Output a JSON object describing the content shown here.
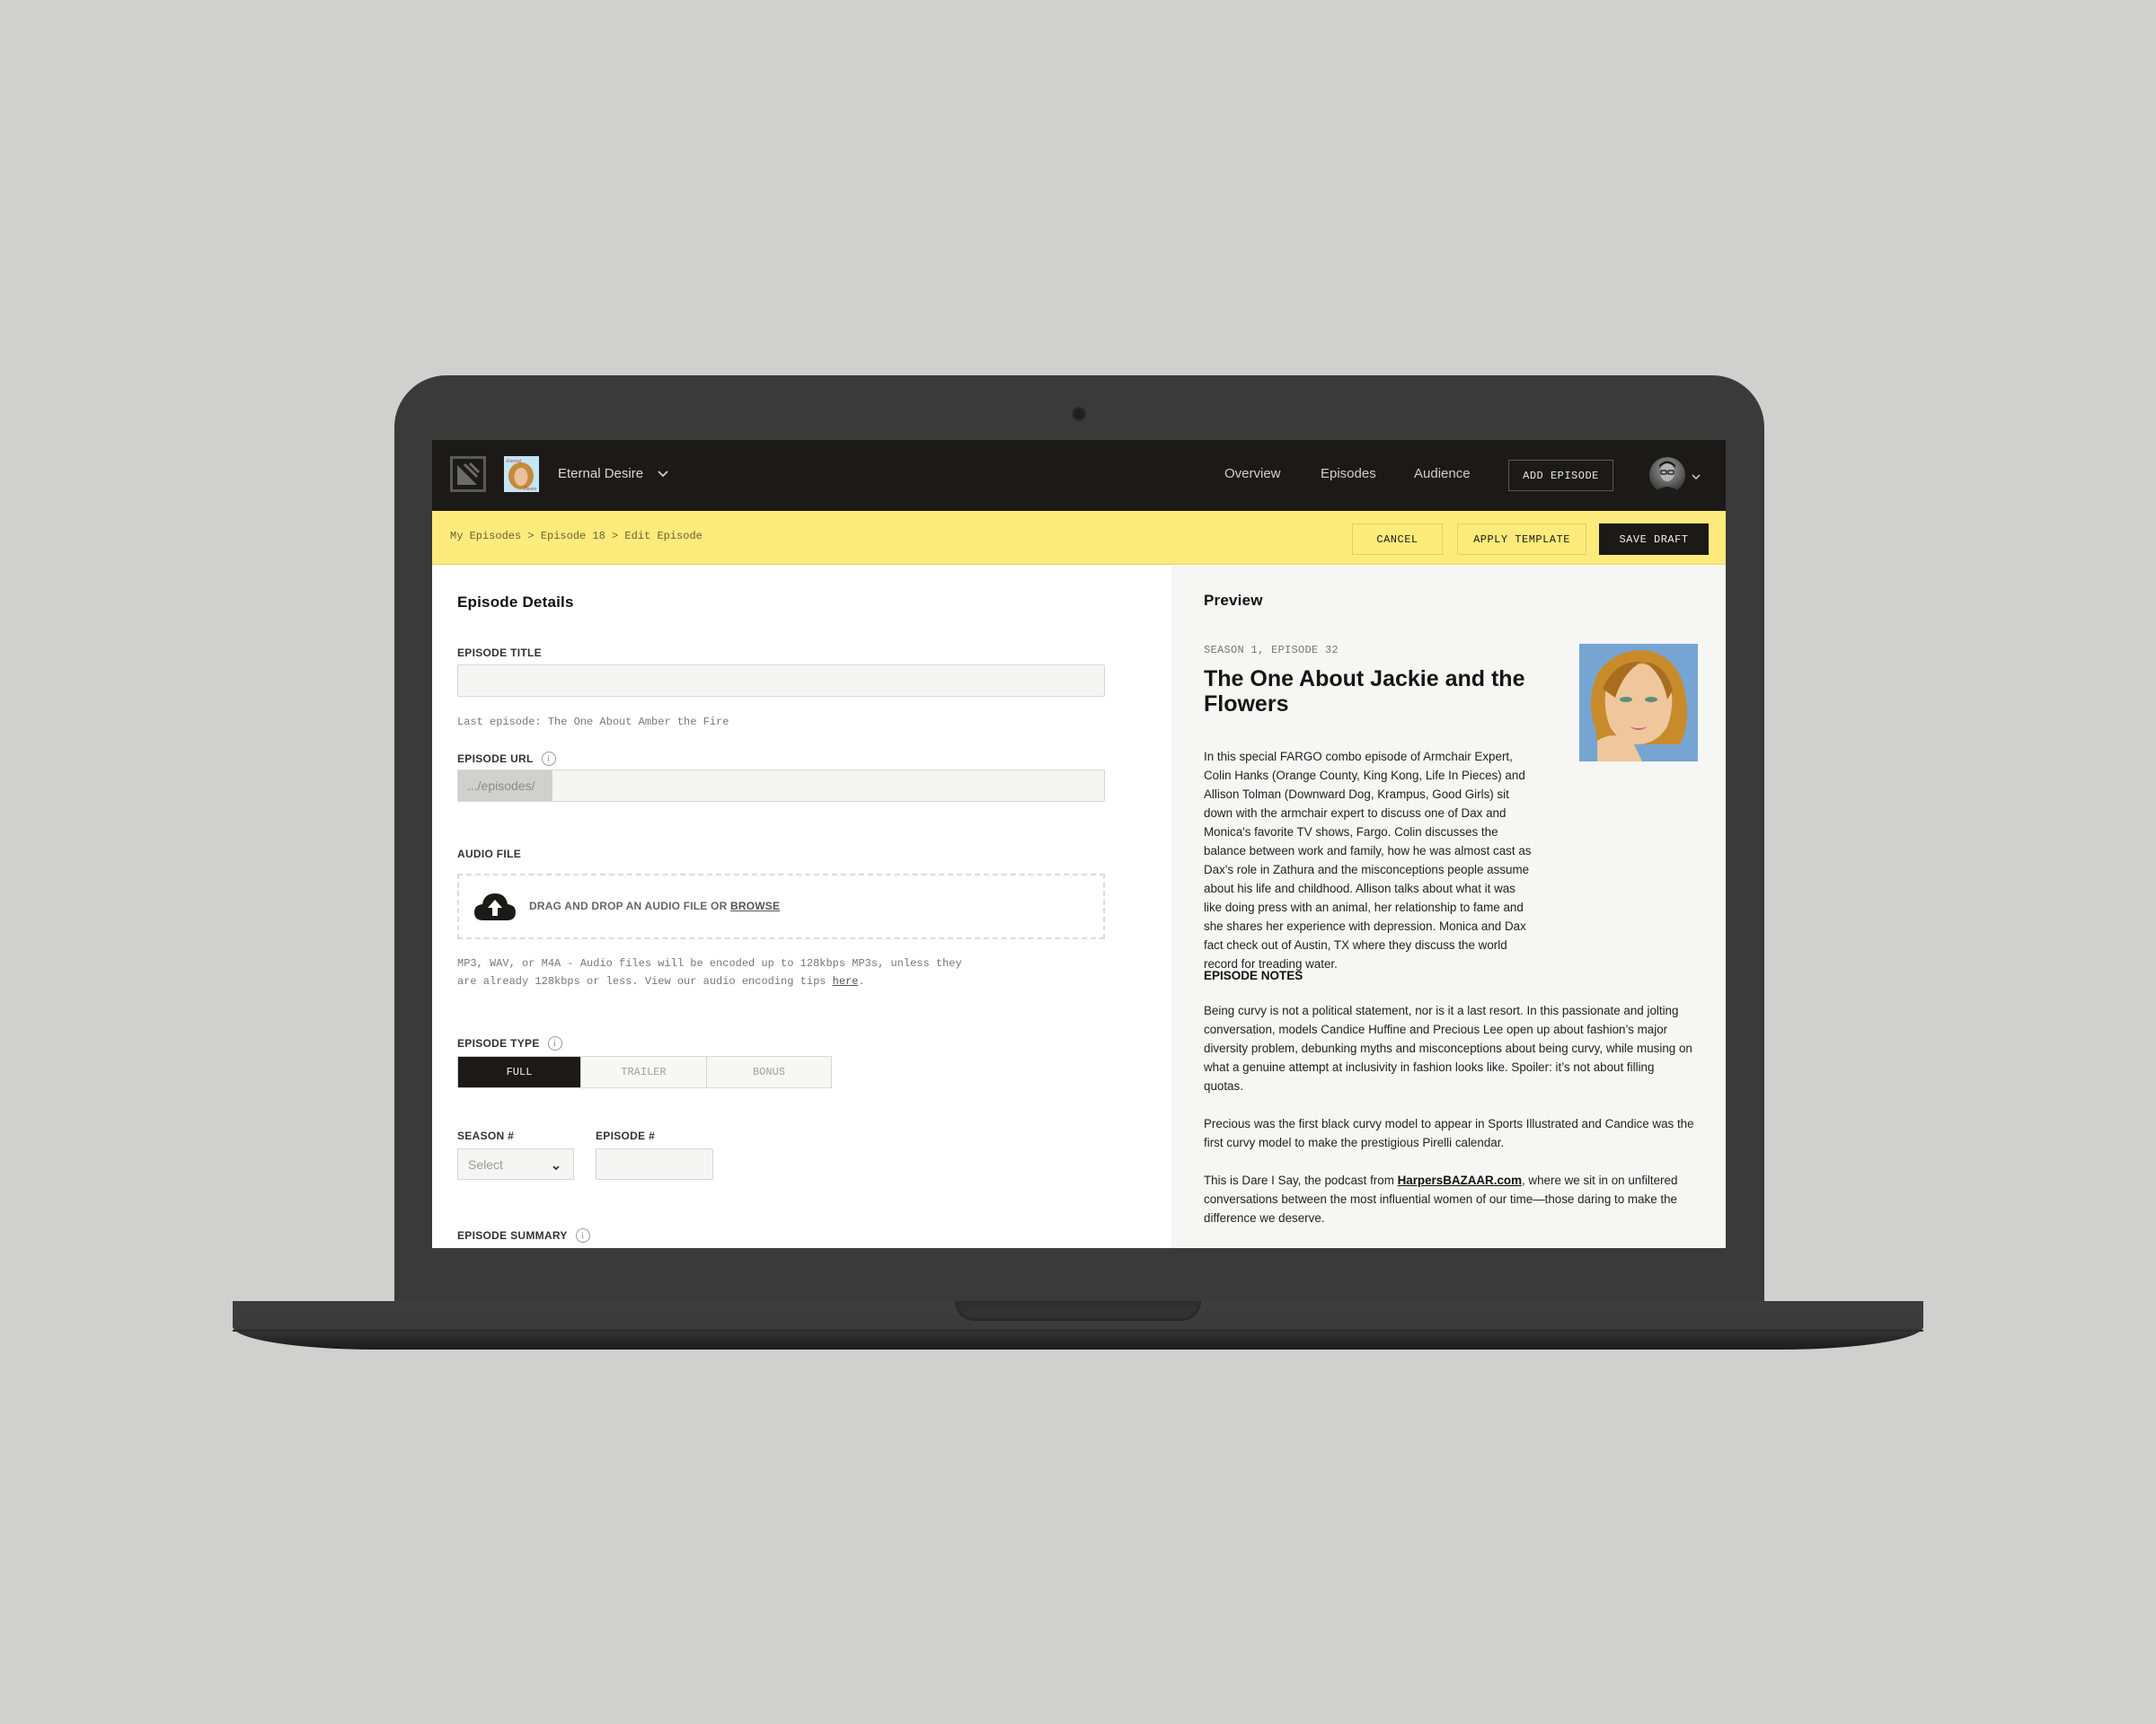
{
  "nav": {
    "podcast_name": "Eternal Desire",
    "links": [
      "Overview",
      "Episodes",
      "Audience"
    ],
    "add_episode_label": "ADD EPISODE",
    "icons": {
      "logo": "brand-logo-icon",
      "podcast_art": "podcast-cover-thumbnail",
      "dropdown": "chevron-down-icon",
      "avatar": "user-avatar"
    }
  },
  "toolbar": {
    "breadcrumb": "My Episodes > Episode 18 > Edit Episode",
    "cancel_label": "CANCEL",
    "apply_template_label": "APPLY TEMPLATE",
    "save_draft_label": "SAVE DRAFT"
  },
  "form": {
    "heading": "Episode Details",
    "episode_title": {
      "label": "EPISODE TITLE",
      "value": "",
      "hint": "Last episode: The One About Amber the Fire"
    },
    "episode_url": {
      "label": "EPISODE URL",
      "prefix": ".../episodes/",
      "value": ""
    },
    "audio_file": {
      "label": "AUDIO FILE",
      "drop_text": "DRAG AND DROP AN AUDIO FILE OR",
      "browse_label": "BROWSE",
      "help_line1": "MP3, WAV, or M4A - Audio files will be encoded up to 128kbps MP3s, unless they",
      "help_line2_prefix": "are already 128kbps or less. View our audio encoding tips ",
      "help_link": "here",
      "help_suffix": "."
    },
    "episode_type": {
      "label": "EPISODE TYPE",
      "options": [
        "FULL",
        "TRAILER",
        "BONUS"
      ],
      "selected": "FULL"
    },
    "season": {
      "label": "SEASON #",
      "placeholder": "Select"
    },
    "episode_number": {
      "label": "EPISODE #",
      "value": ""
    },
    "episode_summary": {
      "label": "EPISODE SUMMARY"
    }
  },
  "preview": {
    "heading": "Preview",
    "meta": "SEASON 1, EPISODE 32",
    "title": "The One About Jackie and the Flowers",
    "description": "In this special FARGO combo episode of Armchair Expert, Colin Hanks (Orange County, King Kong, Life In Pieces) and Allison Tolman (Downward Dog, Krampus, Good Girls) sit down with the armchair expert to discuss one of Dax and Monica's favorite TV shows, Fargo. Colin discusses the balance between work and family, how he was almost cast as Dax's role in Zathura and the misconceptions people assume about his life and childhood. Allison talks about what it was like doing press with an animal, her relationship to fame and she shares her experience with depression. Monica and Dax fact check out of Austin, TX where they discuss the world record for treading water.",
    "notes_heading": "EPISODE NOTES",
    "notes_p1": "Being curvy is not a political statement, nor is it a last resort. In this passionate and jolting conversation, models Candice Huffine and Precious Lee open up about fashion’s major diversity problem, debunking myths and misconceptions about being curvy, while musing on what a genuine attempt at inclusivity in fashion looks like. Spoiler: it’s not about filling quotas.",
    "notes_p2": "Precious was the first black curvy model to appear in Sports Illustrated and Candice was the first curvy model to make the prestigious Pirelli calendar.",
    "notes_p3_prefix": "This is Dare I Say, the podcast from ",
    "notes_p3_link": "HarpersBAZAAR.com",
    "notes_p3_suffix": ", where we sit in on unfiltered conversations between the most influential women of our time—those daring to make the difference we deserve."
  },
  "colors": {
    "nav_bg": "#1c1a17",
    "toolbar_bg": "#fdeb7c",
    "preview_bg": "#f6f6f5",
    "desk_bg": "#d0d0ce",
    "device": "#3a3a3a"
  }
}
